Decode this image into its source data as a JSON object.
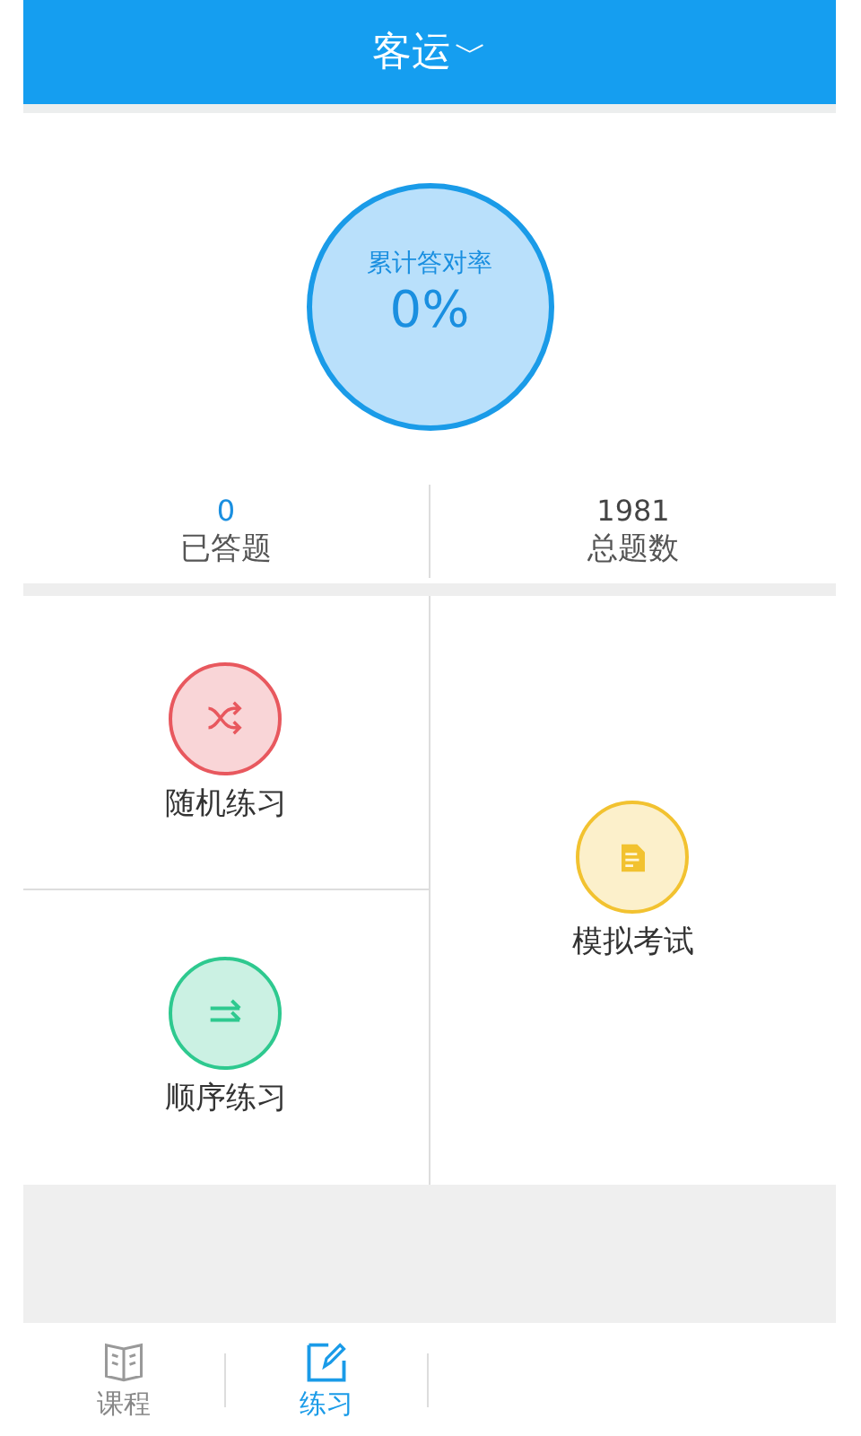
{
  "header": {
    "title": "客运",
    "dropdown_arrow": "﹀"
  },
  "accuracy": {
    "label": "累计答对率",
    "value": "0%"
  },
  "stats": [
    {
      "value": "0",
      "label": "已答题",
      "kind": "highlight"
    },
    {
      "value": "1981",
      "label": "总题数",
      "kind": "plain"
    }
  ],
  "modes": [
    {
      "label": "随机练习",
      "kind": "shuffle",
      "color": "#e8585e"
    },
    {
      "label": "模拟考试",
      "kind": "exam",
      "color": "#f2c230"
    },
    {
      "label": "顺序练习",
      "kind": "sequence",
      "color": "#2ec98f"
    }
  ],
  "tabs": [
    {
      "label": "课程",
      "kind": "book",
      "selected": false
    },
    {
      "label": "练习",
      "kind": "edit",
      "selected": true
    }
  ]
}
